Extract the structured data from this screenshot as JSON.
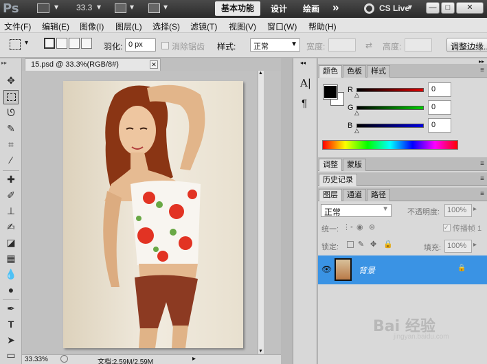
{
  "appbar": {
    "logo": "Ps",
    "zoom": "33.3",
    "workspaces": {
      "active": "基本功能",
      "design": "设计",
      "paint": "绘画",
      "more": "»"
    },
    "cs_live": "CS Live",
    "window_buttons": {
      "minimize": "—",
      "restore": "□",
      "close": "✕"
    }
  },
  "menu": {
    "items": [
      "文件(F)",
      "编辑(E)",
      "图像(I)",
      "图层(L)",
      "选择(S)",
      "滤镜(T)",
      "视图(V)",
      "窗口(W)",
      "帮助(H)"
    ]
  },
  "options": {
    "feather_label": "羽化:",
    "feather_value": "0 px",
    "antialias_label": "消除锯齿",
    "style_label": "样式:",
    "style_value": "正常",
    "width_label": "宽度:",
    "height_label": "高度:",
    "refine_button": "调整边缘..."
  },
  "document": {
    "tab_title": "15.psd @ 33.3%(RGB/8#)",
    "tab_close": "✕",
    "status_zoom": "33.33%",
    "status_doc": "文档:2.59M/2.59M"
  },
  "mid_dock": {
    "char_icon": "A|",
    "para_icon": "¶"
  },
  "color_panel": {
    "tabs": [
      "颜色",
      "色板",
      "样式"
    ],
    "channels": [
      {
        "label": "R",
        "value": "0"
      },
      {
        "label": "G",
        "value": "0"
      },
      {
        "label": "B",
        "value": "0"
      }
    ],
    "foreground_color": "#000000",
    "background_color": "#ffffff"
  },
  "adjust_panel": {
    "tabs": [
      "调整",
      "蒙版"
    ]
  },
  "history_panel": {
    "tabs": [
      "历史记录"
    ]
  },
  "layers_panel": {
    "tabs": [
      "图层",
      "通道",
      "路径"
    ],
    "blend_mode": "正常",
    "opacity_label": "不透明度:",
    "opacity_value": "100%",
    "unify_label": "统一:",
    "propagate_label": "传播帧 1",
    "lock_label": "锁定:",
    "fill_label": "填充:",
    "fill_value": "100%",
    "layers": [
      {
        "name": "背景",
        "selected": true,
        "locked": true
      }
    ]
  },
  "colors": {
    "selection": "#3a93e4",
    "ui_dark": "#2a2a2a",
    "panel": "#d6d6d6"
  },
  "watermark": {
    "text": "Bai 经验",
    "url": "jingyan.baidu.com"
  }
}
